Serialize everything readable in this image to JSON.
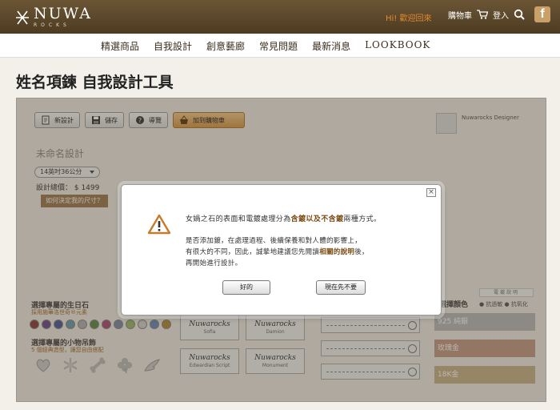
{
  "header": {
    "logo_main": "NUWA",
    "logo_sub": "ROCKS",
    "hi_link": "Hi! 歡迎回來",
    "cart_label": "購物車",
    "login_label": "登入",
    "facebook_letter": "f"
  },
  "nav": [
    "精選商品",
    "自我設計",
    "創意藝廊",
    "常見問題",
    "最新消息",
    "LOOKBOOK"
  ],
  "page_title": "姓名項鍊 自我設計工具",
  "toolbar": {
    "new_label": "新設計",
    "save_label": "儲存",
    "guide_label": "導覽",
    "cart_label": "加到購物車"
  },
  "designer_name": "Nuwarocks Designer",
  "design_name": "未命名設計",
  "size_select": "14英吋36公分",
  "price_label": "設計總價： $ 1499",
  "size_help": "如何決定我的尺寸？",
  "birthstone": {
    "title": "選擇專屬的生日石",
    "subtitle": "採用施華洛世奇®元素",
    "colors": [
      "#8a3a3a",
      "#6b4a8a",
      "#4a5a9a",
      "#6a9ab0",
      "#b0b0b8",
      "#5a8a4a",
      "#aa4a7a",
      "#7a8aa8",
      "#9ab86a",
      "#d0d0d0",
      "#6a8ac0",
      "#b08a3a"
    ]
  },
  "charms": {
    "title": "選擇專屬的小物吊飾",
    "subtitle": "5 個經典造型，讓您自由搭配",
    "icons": [
      "heart-charm-icon",
      "snowflake-charm-icon",
      "bone-charm-icon",
      "clover-charm-icon",
      "wing-charm-icon"
    ]
  },
  "fonts": [
    {
      "sample": "Nuwarocks",
      "label": "Sofia"
    },
    {
      "sample": "Nuwarocks",
      "label": "Damion"
    },
    {
      "sample": "Nuwarocks",
      "label": "Edwardian Script"
    },
    {
      "sample": "Nuwarocks",
      "label": "Monument"
    }
  ],
  "metal": {
    "title": "選擇顏色",
    "plate_note": "電鍍說明",
    "plate_options": "● 抗過敏  ● 抗氧化",
    "options": [
      {
        "label": "925 純銀",
        "color": "#b8b8bc"
      },
      {
        "label": "玫瑰金",
        "color": "#c49a86"
      },
      {
        "label": "18K金",
        "color": "#c8b488"
      }
    ]
  },
  "modal": {
    "headline_pre": "女媧之石的表面和電鍍處理分為",
    "headline_bold": "含鍍以及不含鍍",
    "headline_post": "兩種方式。",
    "body_line1": "是否添加鍍，在處理過程、後續保養和對人體的影響上，",
    "body_line2_pre": "有很大的不同，因此，誠摯地建議您先閱讀",
    "body_line2_bold": "相關的說明",
    "body_line2_post": "後，",
    "body_line3": "再開始進行設計。",
    "close_label": "×",
    "ok_label": "好的",
    "later_label": "現在先不要"
  }
}
